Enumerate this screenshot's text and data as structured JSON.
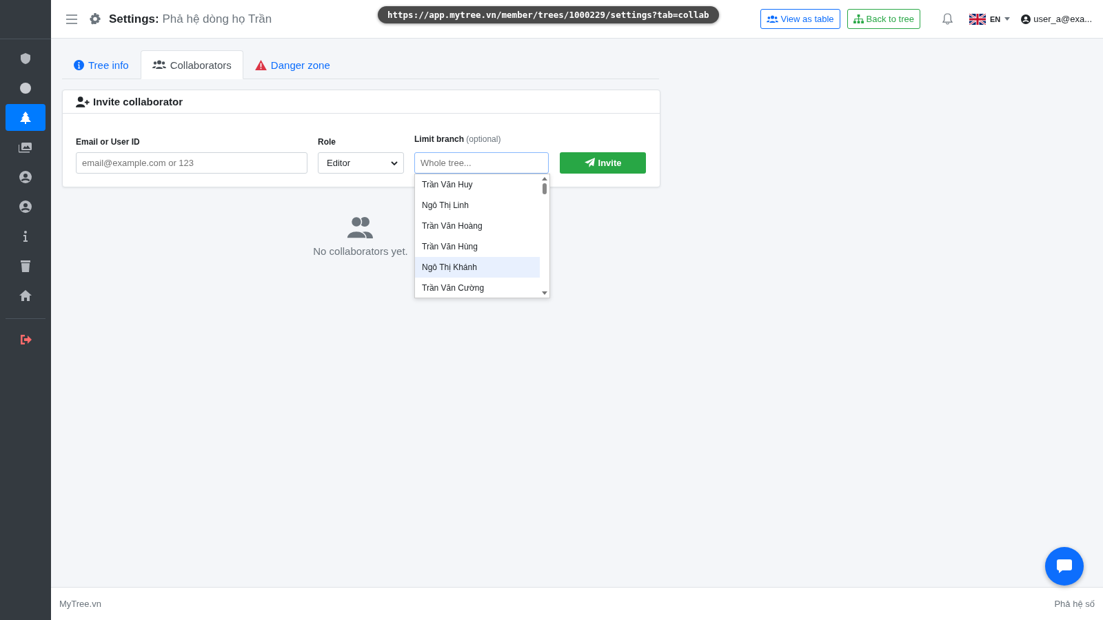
{
  "header": {
    "title_label": "Settings:",
    "title_name": "Phả hệ dòng họ Trần",
    "url": "https://app.mytree.vn/member/trees/1000229/settings?tab=collab",
    "buttons": [
      {
        "label": "View as table",
        "kind": "table"
      },
      {
        "label": "Back to tree",
        "kind": "tree"
      }
    ],
    "language": "EN",
    "user": "user_a@exa..."
  },
  "sidebar": {
    "items": [
      {
        "kind": "shield",
        "selected": false
      },
      {
        "kind": "circle",
        "selected": false
      },
      {
        "kind": "tree",
        "selected": true
      },
      {
        "kind": "images",
        "selected": false
      },
      {
        "kind": "user",
        "selected": false
      },
      {
        "kind": "user",
        "selected": false
      },
      {
        "kind": "info",
        "selected": false
      },
      {
        "kind": "trash",
        "selected": false
      },
      {
        "kind": "home",
        "selected": false
      },
      {
        "kind": "logout",
        "selected": false
      }
    ]
  },
  "tabs": [
    {
      "label": "Tree info",
      "kind": "info",
      "selected": false
    },
    {
      "label": "Collaborators",
      "kind": "users",
      "selected": true
    },
    {
      "label": "Danger zone",
      "kind": "warning",
      "selected": false
    }
  ],
  "invite": {
    "title": "Invite collaborator",
    "email_label": "Email or User ID",
    "email_placeholder": "email@example.com or 123",
    "role_label": "Role",
    "role_value": "Editor",
    "branch_label": "Limit branch",
    "branch_hint": "(optional)",
    "branch_placeholder": "Whole tree...",
    "button": "Invite",
    "options": [
      {
        "name": "Trần Văn Huy",
        "selected": false
      },
      {
        "name": "Ngô Thị Linh",
        "selected": false
      },
      {
        "name": "Trần Văn Hoàng",
        "selected": false
      },
      {
        "name": "Trần Văn Hùng",
        "selected": false
      },
      {
        "name": "Ngô Thị Khánh",
        "selected": true
      },
      {
        "name": "Trần Văn Cường",
        "selected": false
      }
    ]
  },
  "empty": "No collaborators yet.",
  "footer": {
    "left": "MyTree.vn",
    "right": "Phả hệ số"
  }
}
